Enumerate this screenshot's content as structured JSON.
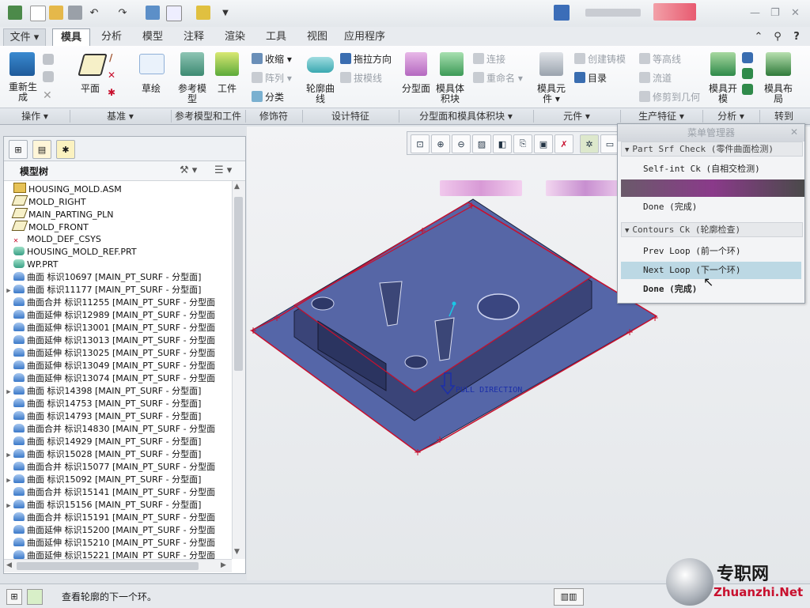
{
  "colors": {
    "accent": "#3b7fc4",
    "curve": "#c8102e",
    "model": "#4a5a9a"
  },
  "ribbon_tabs": [
    "文件",
    "模具",
    "分析",
    "模型",
    "注释",
    "渲染",
    "工具",
    "视图",
    "应用程序"
  ],
  "ribbon": {
    "regen": "重新生成",
    "plane": "平面",
    "sketch": "草绘",
    "ref_model": "参考模型",
    "workpiece": "工件",
    "shrink": "收缩",
    "pattern": "阵列",
    "classify": "分类",
    "contour_curve": "轮廓曲线",
    "pull_dir": "拖拉方向",
    "draft_line": "拔模线",
    "parting_surf": "分型面",
    "mold_volume": "模具体积块",
    "connect": "连接",
    "rename": "重命名",
    "mold_comp": "模具元件",
    "create_casting": "创建铸模",
    "catalog": "目录",
    "contour_line": "等高线",
    "flow": "流道",
    "trim_geom": "修剪到几何",
    "mold_open": "模具开模",
    "mold_layout": "模具布局"
  },
  "groups": [
    "操作",
    "基准",
    "参考模型和工件",
    "修饰符",
    "设计特征",
    "分型面和模具体积块",
    "元件",
    "生产特征",
    "分析",
    "转到"
  ],
  "panel": {
    "title": "模型树"
  },
  "tree": [
    {
      "arrow": "",
      "text": "HOUSING_MOLD.ASM",
      "icon": "asm-icon"
    },
    {
      "arrow": "",
      "text": "MOLD_RIGHT",
      "icon": "datum-plane-icon"
    },
    {
      "arrow": "",
      "text": "MAIN_PARTING_PLN",
      "icon": "datum-plane-icon"
    },
    {
      "arrow": "",
      "text": "MOLD_FRONT",
      "icon": "datum-plane-icon"
    },
    {
      "arrow": "",
      "text": "MOLD_DEF_CSYS",
      "icon": "csys-icon"
    },
    {
      "arrow": "",
      "text": "HOUSING_MOLD_REF.PRT",
      "icon": "part-icon"
    },
    {
      "arrow": "",
      "text": "WP.PRT",
      "icon": "part-icon"
    },
    {
      "arrow": "",
      "text": "曲面 标识10697 [MAIN_PT_SURF - 分型面]",
      "icon": "surface-icon"
    },
    {
      "arrow": "▶",
      "text": "曲面 标识11177 [MAIN_PT_SURF - 分型面]",
      "icon": "surface-icon"
    },
    {
      "arrow": "",
      "text": "曲面合并 标识11255 [MAIN_PT_SURF - 分型面",
      "icon": "surface-icon"
    },
    {
      "arrow": "",
      "text": "曲面延伸 标识12989 [MAIN_PT_SURF - 分型面",
      "icon": "surface-icon"
    },
    {
      "arrow": "",
      "text": "曲面延伸 标识13001 [MAIN_PT_SURF - 分型面",
      "icon": "surface-icon"
    },
    {
      "arrow": "",
      "text": "曲面延伸 标识13013 [MAIN_PT_SURF - 分型面",
      "icon": "surface-icon"
    },
    {
      "arrow": "",
      "text": "曲面延伸 标识13025 [MAIN_PT_SURF - 分型面",
      "icon": "surface-icon"
    },
    {
      "arrow": "",
      "text": "曲面延伸 标识13049 [MAIN_PT_SURF - 分型面",
      "icon": "surface-icon"
    },
    {
      "arrow": "",
      "text": "曲面延伸 标识13074 [MAIN_PT_SURF - 分型面",
      "icon": "surface-icon"
    },
    {
      "arrow": "▶",
      "text": "曲面 标识14398 [MAIN_PT_SURF - 分型面]",
      "icon": "surface-icon"
    },
    {
      "arrow": "",
      "text": "曲面 标识14753 [MAIN_PT_SURF - 分型面]",
      "icon": "surface-icon"
    },
    {
      "arrow": "",
      "text": "曲面 标识14793 [MAIN_PT_SURF - 分型面]",
      "icon": "surface-icon"
    },
    {
      "arrow": "",
      "text": "曲面合并 标识14830 [MAIN_PT_SURF - 分型面",
      "icon": "surface-icon"
    },
    {
      "arrow": "",
      "text": "曲面 标识14929 [MAIN_PT_SURF - 分型面]",
      "icon": "surface-icon"
    },
    {
      "arrow": "▶",
      "text": "曲面 标识15028 [MAIN_PT_SURF - 分型面]",
      "icon": "surface-icon"
    },
    {
      "arrow": "",
      "text": "曲面合并 标识15077 [MAIN_PT_SURF - 分型面",
      "icon": "surface-icon"
    },
    {
      "arrow": "▶",
      "text": "曲面 标识15092 [MAIN_PT_SURF - 分型面]",
      "icon": "surface-icon"
    },
    {
      "arrow": "",
      "text": "曲面合并 标识15141 [MAIN_PT_SURF - 分型面",
      "icon": "surface-icon"
    },
    {
      "arrow": "▶",
      "text": "曲面 标识15156 [MAIN_PT_SURF - 分型面]",
      "icon": "surface-icon"
    },
    {
      "arrow": "",
      "text": "曲面合并 标识15191 [MAIN_PT_SURF - 分型面",
      "icon": "surface-icon"
    },
    {
      "arrow": "",
      "text": "曲面延伸 标识15200 [MAIN_PT_SURF - 分型面",
      "icon": "surface-icon"
    },
    {
      "arrow": "",
      "text": "曲面延伸 标识15210 [MAIN_PT_SURF - 分型面",
      "icon": "surface-icon"
    },
    {
      "arrow": "",
      "text": "曲面延伸 标识15221 [MAIN_PT_SURF - 分型面",
      "icon": "surface-icon"
    }
  ],
  "viewport": {
    "pull_direction": "PULL DIRECTION"
  },
  "menu": {
    "title": "菜单管理器",
    "section1": "Part Srf Check (零件曲面检测)",
    "self_int": "Self-int Ck (自相交检测)",
    "done1": "Done (完成)",
    "section2": "Contours Ck (轮廓检查)",
    "prev_loop": "Prev Loop (前一个环)",
    "next_loop": "Next Loop (下一个环)",
    "done2": "Done (完成)"
  },
  "status": {
    "message": "查看轮廓的下一个环。"
  },
  "watermark": {
    "cn": "专职网",
    "url": "Zhuanzhi.Net"
  }
}
